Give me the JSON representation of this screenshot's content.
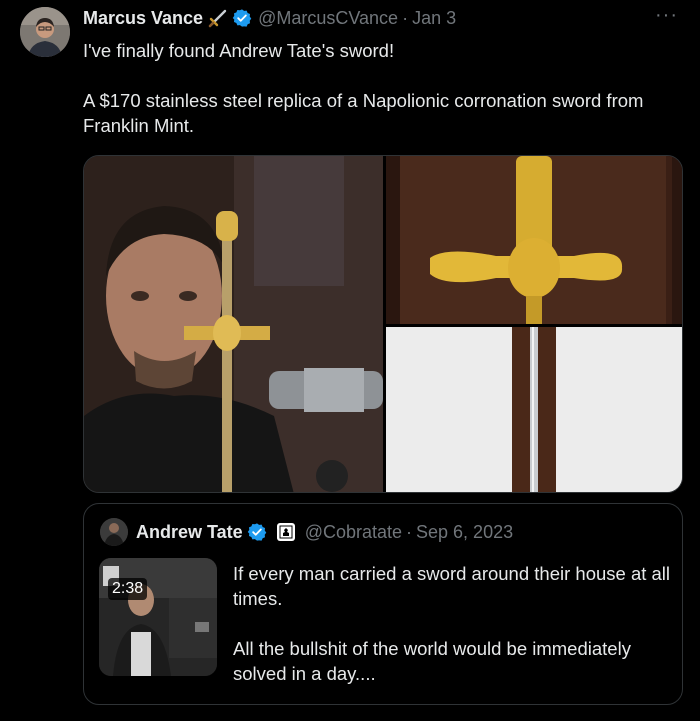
{
  "tweet": {
    "author_name": "Marcus Vance",
    "handle": "@MarcusCVance",
    "separator": "·",
    "date": "Jan 3",
    "text_line1": "I've finally found Andrew Tate's sword!",
    "text_line2": "A $170 stainless steel replica of a Napolionic corronation sword from Franklin Mint.",
    "more_label": "···"
  },
  "quoted_tweet": {
    "author_name": "Andrew Tate",
    "handle": "@Cobratate",
    "separator": "·",
    "date": "Sep 6, 2023",
    "video_duration": "2:38",
    "text_line1": "If every man carried a sword around their house at all times.",
    "text_line2": "All the bullshit of the world would be immediately solved in a day...."
  },
  "icons": {
    "verified": "verified-badge-icon",
    "sword_emoji": "sword-emoji-icon",
    "affiliate": "affiliate-badge-icon",
    "more": "more-options-icon"
  },
  "colors": {
    "background": "#000000",
    "text": "#e7e9ea",
    "secondary": "#71767b",
    "verified_blue": "#1d9bf0",
    "border": "#2f3336"
  }
}
